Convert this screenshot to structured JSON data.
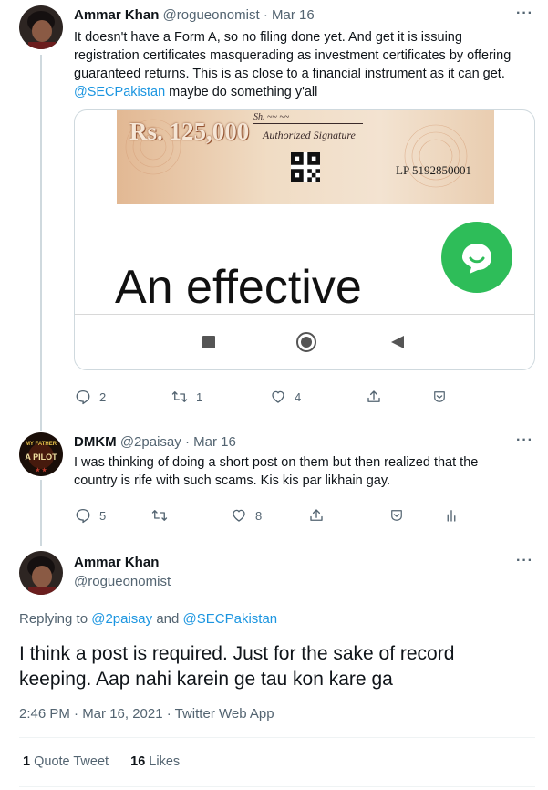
{
  "tweet1": {
    "name": "Ammar Khan",
    "handle": "@rogueonomist",
    "date": "· Mar 16",
    "more": "···",
    "text_line1": "It doesn't have a Form A, so no filing done yet.  And get it is issuing",
    "text_line2": "registration certificates masquerading as investment certificates by offering",
    "text_line3": "guaranteed returns.  This is as close to a financial instrument as it can get.",
    "mention": "@SECPakistan",
    "text_line4_rest": " maybe do something y'all",
    "media": {
      "amount": "Rs. 125,000",
      "signature_label": "Authorized Signature",
      "serial": "LP 5192850001",
      "headline": "An effective",
      "chat_color": "#2ebd59"
    },
    "replies": "2",
    "retweets": "1",
    "likes": "4"
  },
  "tweet2": {
    "name": "DMKM",
    "handle": "@2paisay",
    "date": "· Mar 16",
    "more": "···",
    "avatar_text": "MY FATHER A PILOT",
    "text_line1": "I was thinking of doing a short post on them but then realized that the",
    "text_line2": "country is rife with such scams. Kis kis par likhain gay.",
    "replies": "5",
    "retweets": "",
    "likes": "8"
  },
  "tweet3": {
    "name": "Ammar Khan",
    "handle": "@rogueonomist",
    "more": "···",
    "replying_prefix": "Replying to",
    "reply_user1": "@2paisay",
    "reply_and": "and",
    "reply_user2": "@SECPakistan",
    "text_line1": "I think a post is required.  Just for the sake of record",
    "text_line2": "keeping.  Aap nahi karein ge tau kon kare ga",
    "timestamp": "2:46 PM · Mar 16, 2021 · Twitter Web App",
    "quote_count": "1",
    "quote_label": "Quote Tweet",
    "like_count": "16",
    "like_label": "Likes"
  },
  "colors": {
    "link": "#1b95e0",
    "muted": "#536471",
    "text": "#0f1419"
  }
}
